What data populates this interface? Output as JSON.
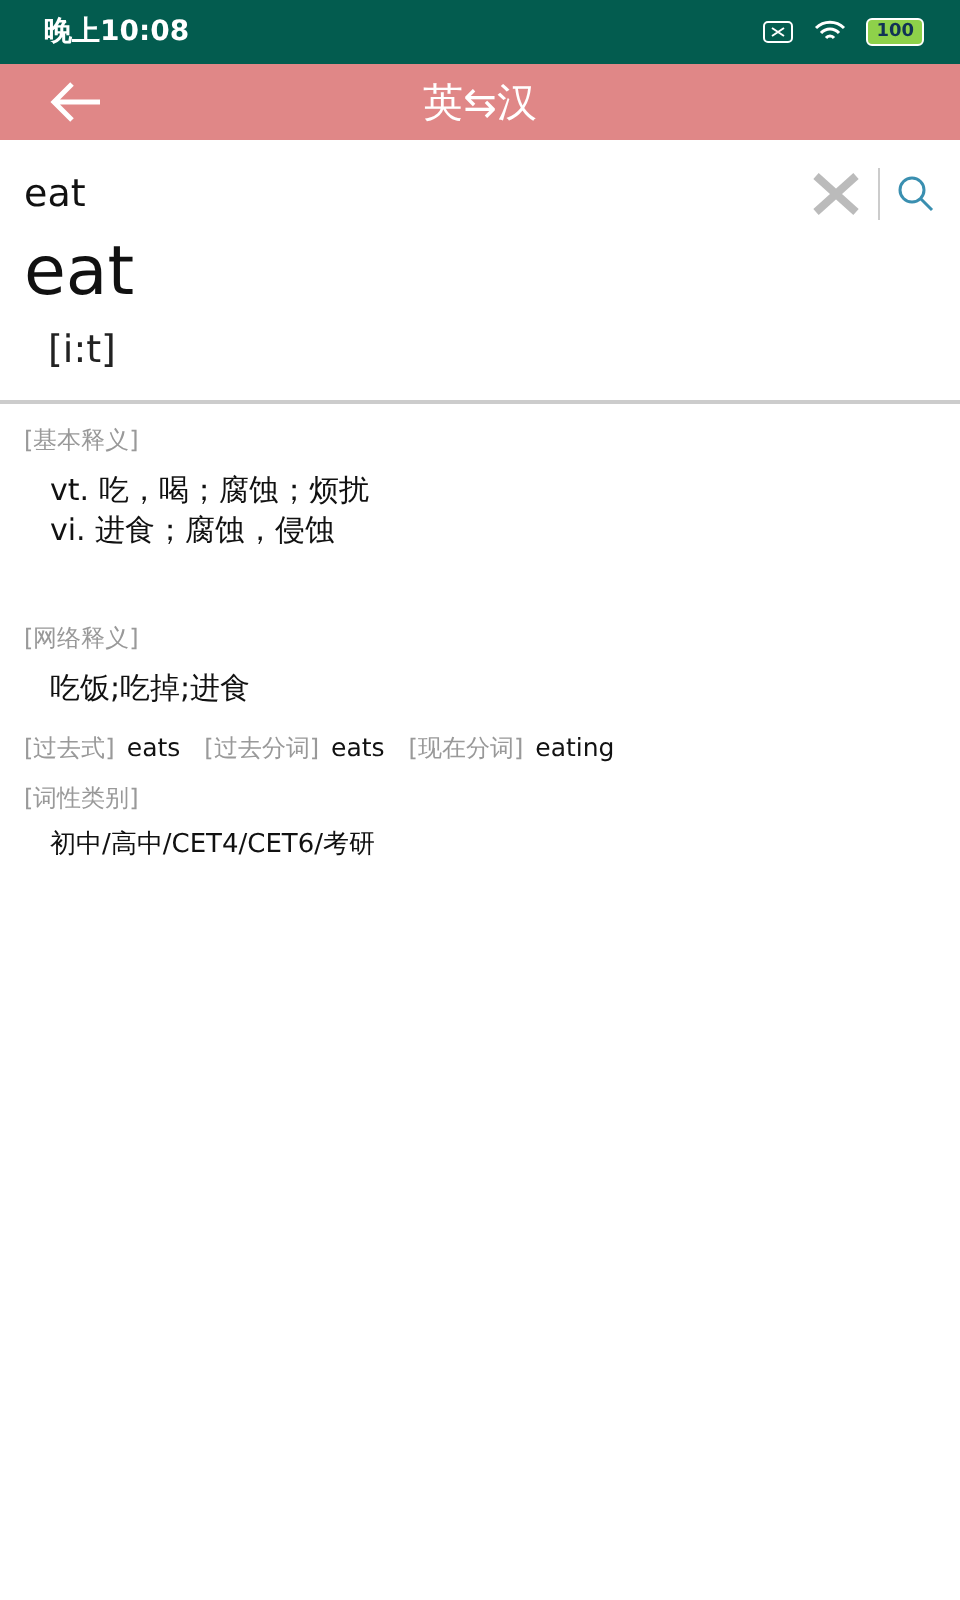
{
  "status_bar": {
    "time": "晚上10:08",
    "battery": "100"
  },
  "header": {
    "title": "英⇆汉"
  },
  "search": {
    "value": "eat"
  },
  "entry": {
    "word": "eat",
    "phonetic": "[i:t]"
  },
  "basic": {
    "label": "[基本释义]",
    "lines": [
      "vt. 吃，喝；腐蚀；烦扰",
      "vi. 进食；腐蚀，侵蚀"
    ]
  },
  "web": {
    "label": "[网络释义]",
    "text": "吃饭;吃掉;进食"
  },
  "forms": [
    {
      "label": "[过去式]",
      "value": "eats"
    },
    {
      "label": "[过去分词]",
      "value": "eats"
    },
    {
      "label": "[现在分词]",
      "value": "eating"
    }
  ],
  "category": {
    "label": "[词性类别]",
    "text": "初中/高中/CET4/CET6/考研"
  }
}
